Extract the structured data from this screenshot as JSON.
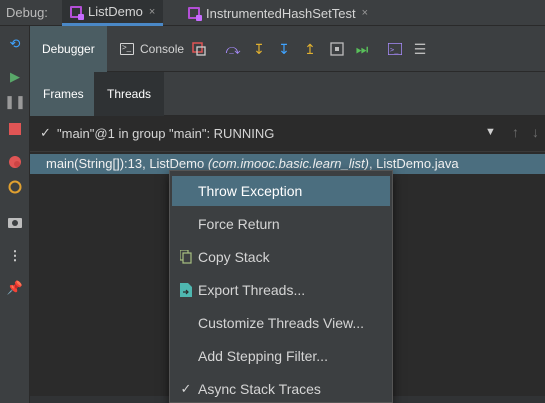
{
  "topbar": {
    "debug_label": "Debug:",
    "tabs": [
      {
        "label": "ListDemo",
        "active": true
      },
      {
        "label": "InstrumentedHashSetTest",
        "active": false
      }
    ],
    "close_glyph": "×"
  },
  "debugger_toolbar": {
    "debugger_tab": "Debugger",
    "console_tab": "Console",
    "icons": [
      "show-execution-point-icon",
      "step-over-icon",
      "step-into-icon",
      "force-step-into-icon",
      "step-out-icon",
      "drop-frame-icon",
      "run-to-cursor-icon",
      "evaluate-expression-icon",
      "trace-current-stream-icon"
    ]
  },
  "subtabs": {
    "frames": "Frames",
    "threads": "Threads"
  },
  "thread": {
    "check": "✓",
    "text": "\"main\"@1 in group \"main\": RUNNING"
  },
  "frame": {
    "method": "main(String[]):13, ListDemo ",
    "package": "(com.imooc.basic.learn_list)",
    "file": ", ListDemo.java"
  },
  "context_menu": {
    "items": [
      {
        "label": "Throw Exception",
        "icon": "",
        "highlight": true
      },
      {
        "label": "Force Return",
        "icon": "",
        "highlight": false
      },
      {
        "label": "Copy Stack",
        "icon": "copy-icon",
        "highlight": false
      },
      {
        "label": "Export Threads...",
        "icon": "export-icon",
        "highlight": false
      },
      {
        "label": "Customize Threads View...",
        "icon": "",
        "highlight": false
      },
      {
        "label": "Add Stepping Filter...",
        "icon": "",
        "highlight": false
      },
      {
        "label": "Async Stack Traces",
        "icon": "check-icon",
        "highlight": false
      }
    ]
  },
  "colors": {
    "accent": "#4a88c7",
    "selection": "#4b6e7f",
    "tab_icon": "#b34fd6"
  }
}
